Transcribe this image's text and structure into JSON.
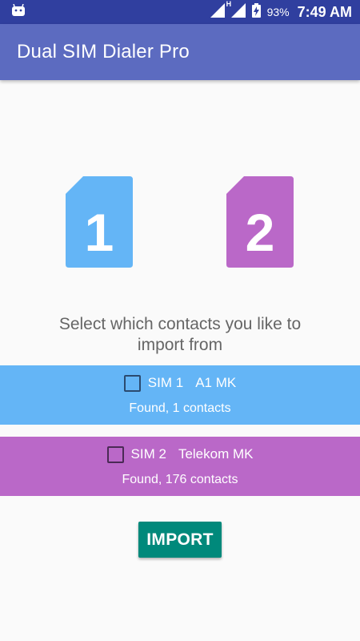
{
  "status_bar": {
    "battery_percent": "93%",
    "time": "7:49 AM",
    "network_type": "H",
    "icons": [
      "android-debug-icon",
      "signal-icon",
      "signal-h-icon",
      "battery-charging-icon"
    ]
  },
  "app_bar": {
    "title": "Dual SIM Dialer Pro",
    "color": "#5c6bc0"
  },
  "sims": [
    {
      "number": "1",
      "color": "#64b5f6"
    },
    {
      "number": "2",
      "color": "#ba68c8"
    }
  ],
  "prompt": {
    "line1": "Select which contacts you like to",
    "line2": "import from"
  },
  "sim_rows": [
    {
      "sim_label": "SIM 1",
      "carrier": "A1 MK",
      "found": "Found, 1 contacts",
      "checked": false
    },
    {
      "sim_label": "SIM 2",
      "carrier": "Telekom MK",
      "found": "Found, 176 contacts",
      "checked": false
    }
  ],
  "import_button": {
    "label": "IMPORT",
    "color": "#00897b"
  }
}
